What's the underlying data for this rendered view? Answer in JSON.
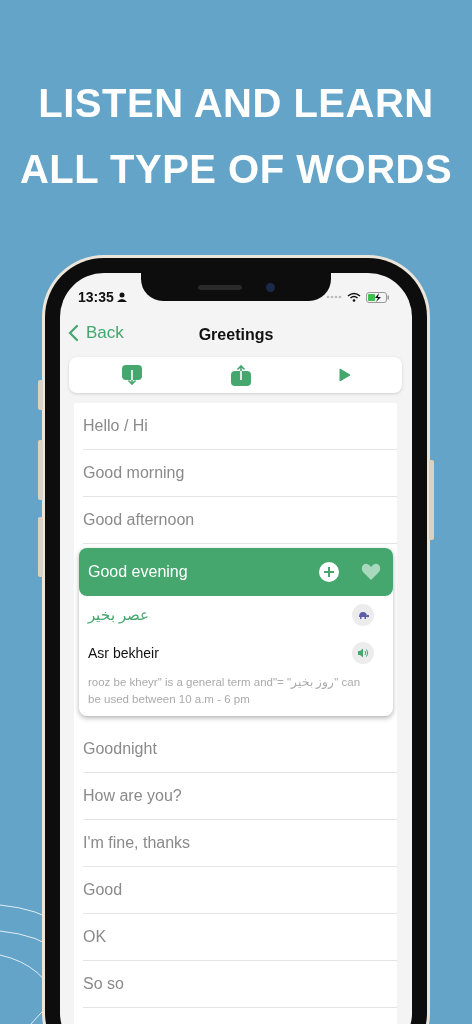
{
  "headline": [
    "LISTEN AND LEARN",
    "ALL TYPE OF WORDS"
  ],
  "status_bar": {
    "time": "13:35"
  },
  "nav": {
    "back": "Back",
    "title": "Greetings"
  },
  "phrases": [
    {
      "text": "Hello / Hi",
      "expanded": false
    },
    {
      "text": "Good morning",
      "expanded": false
    },
    {
      "text": "Good afternoon",
      "expanded": false
    },
    {
      "text": "Good evening",
      "expanded": true,
      "favorite": false,
      "persian": "عصر بخیر",
      "transliteration": "Asr bekheir",
      "note": "rooz be kheyr\"  is a general term and\"= \"روز بخیر\" can be used between 10 a.m - 6 pm"
    },
    {
      "text": "Goodnight",
      "expanded": false
    },
    {
      "text": "How are you?",
      "expanded": false
    },
    {
      "text": "I'm fine, thanks",
      "expanded": false
    },
    {
      "text": "Good",
      "expanded": false
    },
    {
      "text": "OK",
      "expanded": false
    },
    {
      "text": "So so",
      "expanded": false
    }
  ]
}
